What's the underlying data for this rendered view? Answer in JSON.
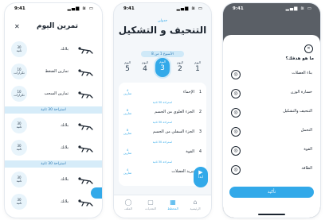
{
  "status": {
    "time": "9:41",
    "icons": "▂▄▆ ≋ ▭"
  },
  "phone1": {
    "title": "تمرين اليوم",
    "close": "✕",
    "exercises": [
      {
        "name": "بلانك",
        "count": "30",
        "unit": "ثانية"
      },
      {
        "name": "تمارين الضغط",
        "count": "10",
        "unit": "تكرارات"
      },
      {
        "name": "تمارين السحب",
        "count": "10",
        "unit": "تكرارات"
      },
      {
        "name": "بلانك",
        "count": "30",
        "unit": "ثانية"
      },
      {
        "name": "بلانك",
        "count": "30",
        "unit": "ثانية"
      },
      {
        "name": "بلانك",
        "count": "30",
        "unit": "ثانية"
      },
      {
        "name": "بلانك",
        "count": "30",
        "unit": "ثانية"
      }
    ],
    "rest_label": "استراحة 30 ثانية"
  },
  "phone2": {
    "subtitle": "جدولي",
    "title": "التنحيف و التشكيل",
    "week_label": "الأسبوع 1 من 8",
    "days": [
      {
        "label": "اليوم",
        "num": "5"
      },
      {
        "label": "اليوم",
        "num": "4"
      },
      {
        "label": "اليوم",
        "num": "3",
        "active": true
      },
      {
        "label": "اليوم",
        "num": "2"
      },
      {
        "label": "اليوم",
        "num": "1"
      }
    ],
    "plan": [
      {
        "n": "1",
        "title": "الإحماء",
        "count": "4",
        "unit": "تمارين"
      },
      {
        "n": "2",
        "title": "الجزء العلوي من الجسم",
        "count": "8",
        "unit": "تمارين"
      },
      {
        "n": "3",
        "title": "الجزء السفلي من الجسم",
        "count": "8",
        "unit": "تمارين"
      },
      {
        "n": "4",
        "title": "القوة",
        "count": "4",
        "unit": "تمارين"
      },
      {
        "n": "5",
        "title": "تبريد العضلات",
        "count": "4",
        "unit": "تمارين"
      }
    ],
    "plan_rest": "استراحة 30 ثانية",
    "start_label": "ابدأ",
    "nav": [
      {
        "label": "الملف",
        "icon": "◯"
      },
      {
        "label": "التحديات",
        "icon": "▢"
      },
      {
        "label": "المخطط",
        "icon": "▦",
        "active": true
      },
      {
        "label": "الرئيسية",
        "icon": "⌂"
      }
    ]
  },
  "phone3": {
    "close": "✕",
    "question": "ما هو هدفك؟",
    "goals": [
      {
        "label": "بناء العضلات",
        "icon": "◎"
      },
      {
        "label": "خسارة الوزن",
        "icon": "◎"
      },
      {
        "label": "التنحيف والتشكيل",
        "icon": "◎"
      },
      {
        "label": "التحمل",
        "icon": "◎"
      },
      {
        "label": "القوة",
        "icon": "◎"
      },
      {
        "label": "الطاقة",
        "icon": "◎"
      }
    ],
    "confirm_label": "تأكيد"
  }
}
